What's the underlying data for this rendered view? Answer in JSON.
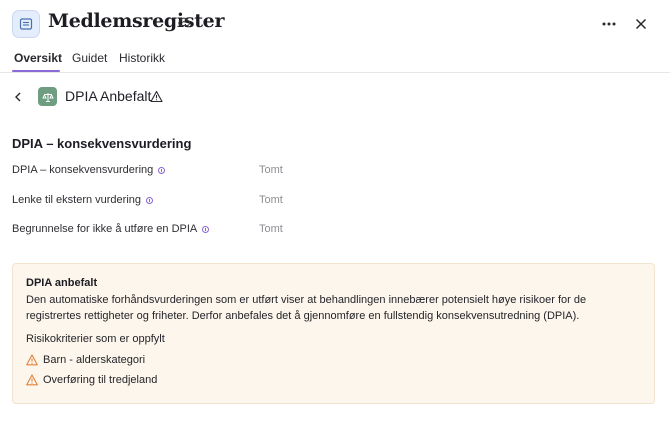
{
  "header": {
    "title": "Medlemsregister",
    "icons": {
      "app": "list-icon",
      "sync": "cloud-sync-icon",
      "more": "more-horizontal-icon",
      "close": "close-icon"
    }
  },
  "tabs": [
    {
      "label": "Oversikt",
      "active": true
    },
    {
      "label": "Guidet",
      "active": false
    },
    {
      "label": "Historikk",
      "active": false
    }
  ],
  "subheader": {
    "title": "DPIA Anbefalt",
    "icons": {
      "back": "chevron-left-icon",
      "type": "scale-icon",
      "warning": "warning-icon"
    }
  },
  "section": {
    "title": "DPIA – konsekvensvurdering",
    "fields": [
      {
        "label": "DPIA – konsekvensvurdering",
        "value": "Tomt"
      },
      {
        "label": "Lenke til ekstern vurdering",
        "value": "Tomt"
      },
      {
        "label": "Begrunnelse for ikke å utføre en DPIA",
        "value": "Tomt"
      }
    ]
  },
  "callout": {
    "title": "DPIA anbefalt",
    "text": "Den automatiske forhåndsvurderingen som er utført viser at behandlingen innebærer potensielt høye risikoer for de registrertes rettigheter og friheter. Derfor anbefales det å gjennomføre en fullstendig konsekvensutredning (DPIA).",
    "criteria_title": "Risikokriterier som er oppfylt",
    "criteria": [
      {
        "label": "Barn - alderskategori",
        "icon": "warning-icon"
      },
      {
        "label": "Overføring til tredjeland",
        "icon": "warning-icon"
      }
    ]
  },
  "colors": {
    "accent": "#8b6ad6",
    "callout_bg": "#fdf6ec",
    "warning": "#e0823a",
    "dpia_icon_bg": "#6e9d82"
  }
}
